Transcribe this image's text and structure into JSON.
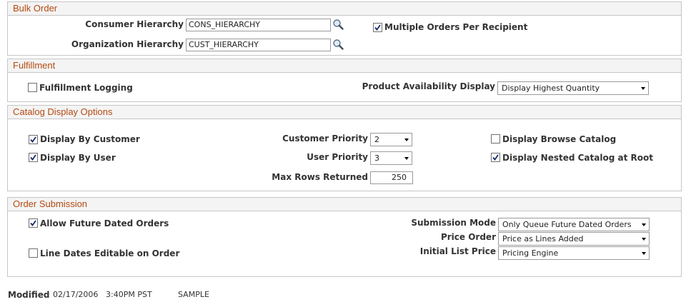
{
  "bulk_order": {
    "header": "Bulk Order",
    "consumer_hierarchy_label": "Consumer Hierarchy",
    "consumer_hierarchy_value": "CONS_HIERARCHY",
    "organization_hierarchy_label": "Organization Hierarchy",
    "organization_hierarchy_value": "CUST_HIERARCHY",
    "multiple_orders_label": "Multiple Orders Per Recipient",
    "multiple_orders_checked": true
  },
  "fulfillment": {
    "header": "Fulfillment",
    "fulfillment_logging_label": "Fulfillment Logging",
    "fulfillment_logging_checked": false,
    "product_availability_label": "Product Availability Display",
    "product_availability_value": "Display Highest Quantity"
  },
  "catalog_display": {
    "header": "Catalog Display Options",
    "display_by_customer_label": "Display By Customer",
    "display_by_customer_checked": true,
    "display_by_user_label": "Display By User",
    "display_by_user_checked": true,
    "customer_priority_label": "Customer Priority",
    "customer_priority_value": "2",
    "user_priority_label": "User Priority",
    "user_priority_value": "3",
    "max_rows_label": "Max Rows Returned",
    "max_rows_value": "250",
    "display_browse_catalog_label": "Display Browse Catalog",
    "display_browse_catalog_checked": false,
    "display_nested_catalog_label": "Display Nested Catalog at Root",
    "display_nested_catalog_checked": true
  },
  "order_submission": {
    "header": "Order Submission",
    "allow_future_dated_label": "Allow Future Dated Orders",
    "allow_future_dated_checked": true,
    "line_dates_editable_label": "Line Dates Editable on Order",
    "line_dates_editable_checked": false,
    "submission_mode_label": "Submission Mode",
    "submission_mode_value": "Only Queue Future Dated Orders",
    "price_order_label": "Price Order",
    "price_order_value": "Price as Lines Added",
    "initial_list_price_label": "Initial List Price",
    "initial_list_price_value": "Pricing Engine"
  },
  "footer": {
    "modified_label": "Modified",
    "modified_date": "02/17/2006",
    "modified_time": "3:40PM PST",
    "modified_by": "SAMPLE"
  },
  "icons": {
    "lookup": "magnifier-icon",
    "dropdown": "chevron-down-icon",
    "checkbox_check": "checkmark-icon"
  },
  "colors": {
    "section_header_text": "#b34a12",
    "section_header_bg": "#f4f4f4",
    "border": "#c6c6c6"
  }
}
